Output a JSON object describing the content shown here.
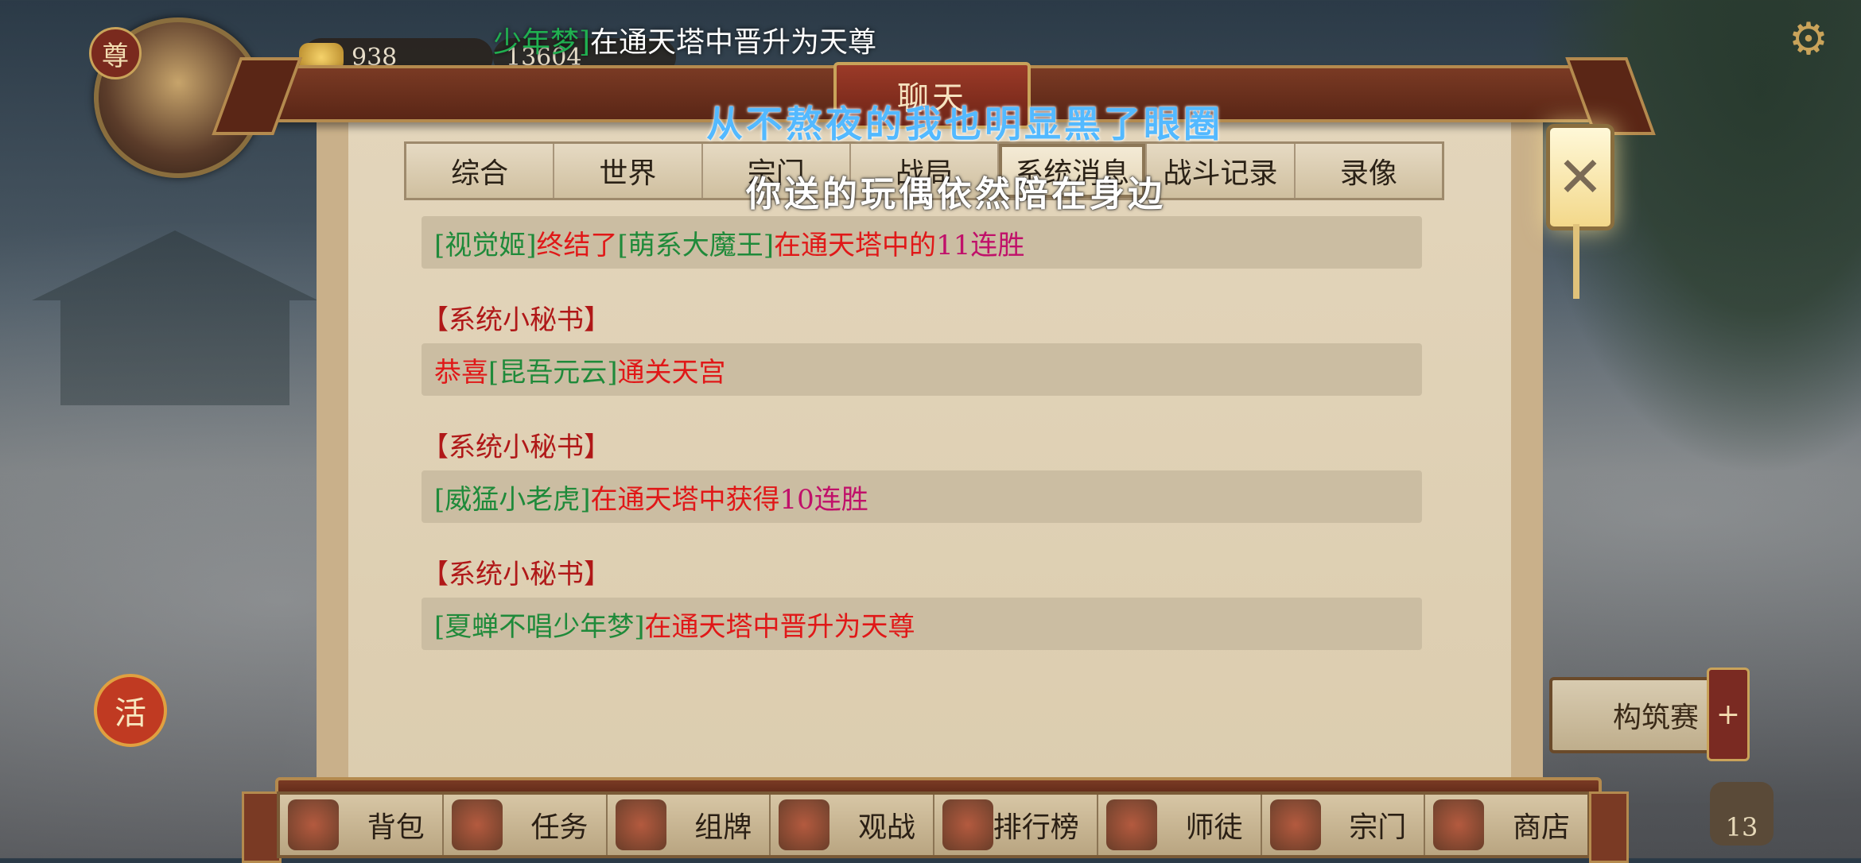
{
  "hud": {
    "rank_badge": "尊",
    "currency_gold": "938",
    "currency_secondary": "13604",
    "broadcast_name": "少年梦]",
    "broadcast_text": "在通天塔中晋升为天尊",
    "activity_badge": "活"
  },
  "dialog": {
    "title": "聊天",
    "tabs": [
      "综合",
      "世界",
      "宗门",
      "战局",
      "系统消息",
      "战斗记录",
      "录像"
    ],
    "active_tab_index": 4
  },
  "messages": [
    {
      "sender": "",
      "segments": [
        {
          "t": "[视觉姬]",
          "c": "g"
        },
        {
          "t": "终结了",
          "c": "r"
        },
        {
          "t": "[萌系大魔王]",
          "c": "g"
        },
        {
          "t": "在通天塔中的",
          "c": "r"
        },
        {
          "t": "11连胜",
          "c": "m"
        }
      ]
    },
    {
      "sender": "【系统小秘书】",
      "segments": [
        {
          "t": "恭喜",
          "c": "r"
        },
        {
          "t": "[昆吾元云]",
          "c": "g"
        },
        {
          "t": "通关天宫",
          "c": "r"
        }
      ]
    },
    {
      "sender": "【系统小秘书】",
      "segments": [
        {
          "t": "[威猛小老虎]",
          "c": "g"
        },
        {
          "t": "在通天塔中获得",
          "c": "r"
        },
        {
          "t": "10连胜",
          "c": "m"
        }
      ]
    },
    {
      "sender": "【系统小秘书】",
      "segments": [
        {
          "t": "[夏蝉不唱少年梦]",
          "c": "g"
        },
        {
          "t": "在通天塔中晋升为天尊",
          "c": "r"
        }
      ]
    }
  ],
  "lyrics": {
    "line1": "从不熬夜的我也明显黑了眼圈",
    "line2": "你送的玩偶依然陪在身边"
  },
  "side": {
    "close_icon": "close-icon",
    "tournament_label": "构筑赛",
    "plus": "+",
    "mail_count": "13"
  },
  "bottom_nav": [
    "背包",
    "任务",
    "组牌",
    "观战",
    "排行榜",
    "师徒",
    "宗门",
    "商店"
  ],
  "colors": {
    "green": "#1f8a3a",
    "red": "#e01818",
    "magenta": "#c0106a",
    "frame": "#5a2616"
  }
}
